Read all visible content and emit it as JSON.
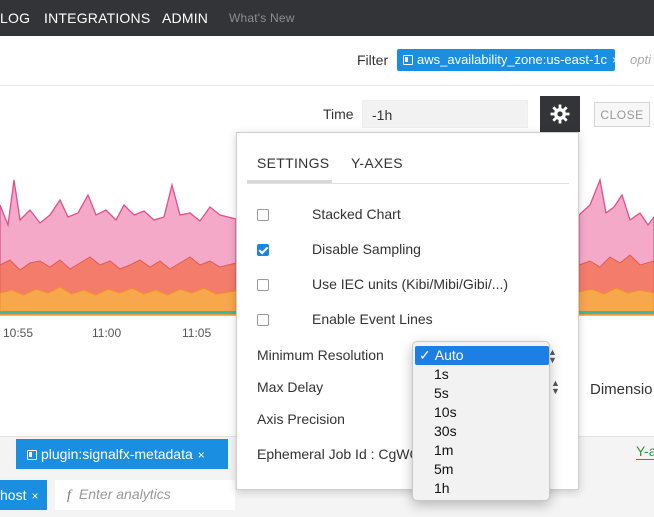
{
  "nav": {
    "items": [
      "LOG",
      "INTEGRATIONS",
      "ADMIN"
    ],
    "whats_new": "What's New"
  },
  "filter": {
    "label": "Filter",
    "chip": "aws_availability_zone:us-east-1c",
    "input_placeholder": "opti"
  },
  "toolbar": {
    "time_label": "Time",
    "time_value": "-1h",
    "close_label": "CLOSE",
    "gear_icon": "gear-icon"
  },
  "chart": {
    "x_ticks": [
      "10:55",
      "11:00",
      "11:05"
    ],
    "colors": {
      "pink": "#f4a9c8",
      "pink_line": "#e0508f",
      "red": "#f47c6b",
      "orange": "#f7a74c",
      "teal": "#3bb9a6"
    }
  },
  "panel": {
    "tabs": [
      "SETTINGS",
      "Y-AXES"
    ],
    "checkboxes": [
      {
        "label": "Stacked Chart",
        "checked": false
      },
      {
        "label": "Disable Sampling",
        "checked": true
      },
      {
        "label": "Use IEC units (Kibi/Mibi/Gibi/...)",
        "checked": false
      },
      {
        "label": "Enable Event Lines",
        "checked": false
      }
    ],
    "min_resolution_label": "Minimum Resolution",
    "max_delay_label": "Max Delay",
    "axis_precision_label": "Axis Precision",
    "job_id_label": "Ephemeral Job Id : CgWC"
  },
  "dropdown": {
    "selected": "Auto",
    "check": "✓",
    "options": [
      "1s",
      "5s",
      "10s",
      "30s",
      "1m",
      "5m",
      "1h"
    ]
  },
  "right": {
    "dimension_label": "Dimensio",
    "y_axes_link": "Y-a"
  },
  "bottom": {
    "chip_metadata": "plugin:signalfx-metadata",
    "chip_host": "host",
    "chip_close": "×",
    "analytics_icon": "f",
    "analytics_placeholder": "Enter analytics"
  }
}
